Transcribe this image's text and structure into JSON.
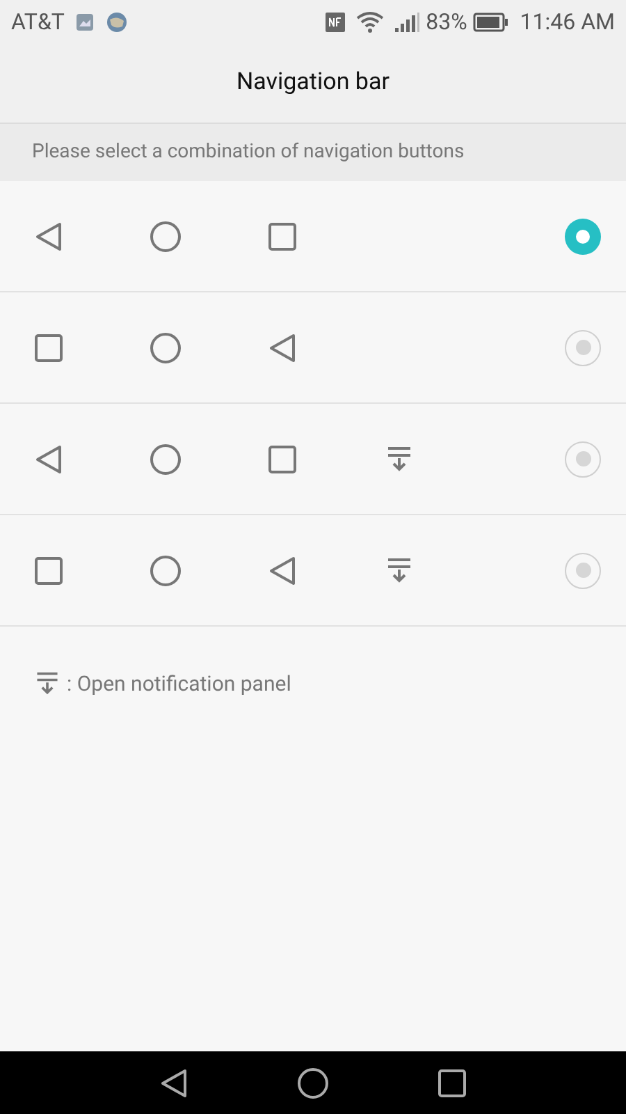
{
  "status_bar": {
    "carrier": "AT&T",
    "battery": "83%",
    "time": "11:46 AM"
  },
  "title": "Navigation bar",
  "subheader": "Please select a combination of navigation buttons",
  "options": [
    {
      "selected": true,
      "buttons": [
        {
          "kind": "back"
        },
        {
          "kind": "home"
        },
        {
          "kind": "recent"
        }
      ]
    },
    {
      "selected": false,
      "buttons": [
        {
          "kind": "recent"
        },
        {
          "kind": "home"
        },
        {
          "kind": "back"
        }
      ]
    },
    {
      "selected": false,
      "buttons": [
        {
          "kind": "back"
        },
        {
          "kind": "home"
        },
        {
          "kind": "recent"
        },
        {
          "kind": "notification"
        }
      ]
    },
    {
      "selected": false,
      "buttons": [
        {
          "kind": "recent"
        },
        {
          "kind": "home"
        },
        {
          "kind": "back"
        },
        {
          "kind": "notification"
        }
      ]
    }
  ],
  "legend": {
    "kind": "notification",
    "text": ": Open notification panel"
  },
  "nav_bar": [
    {
      "kind": "back"
    },
    {
      "kind": "home"
    },
    {
      "kind": "recent"
    }
  ]
}
